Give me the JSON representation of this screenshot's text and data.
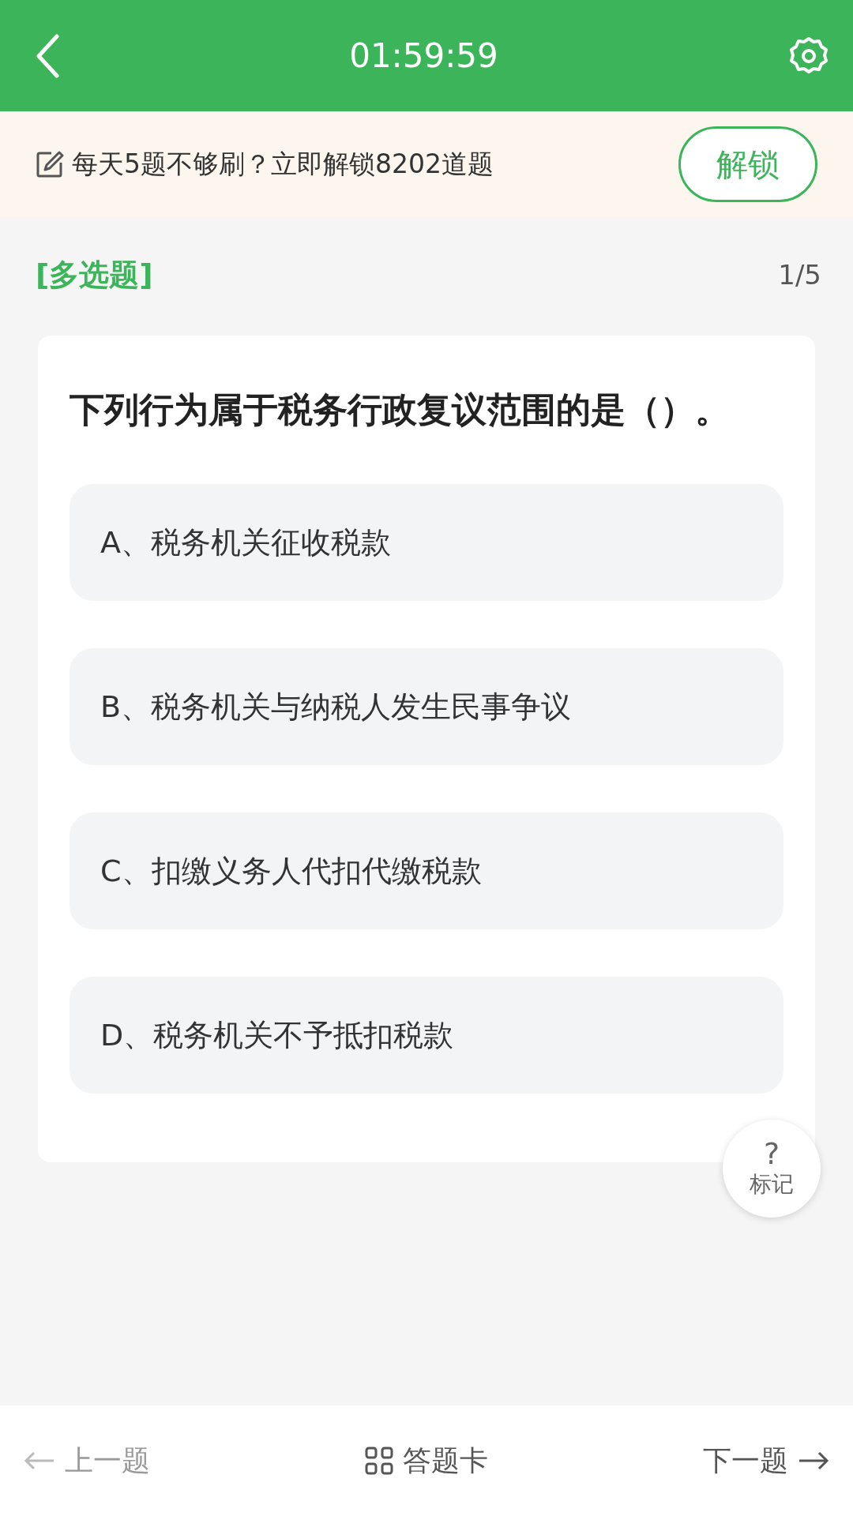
{
  "header": {
    "timer": "01:59:59"
  },
  "banner": {
    "text": "每天5题不够刷？立即解锁8202道题",
    "button": "解锁"
  },
  "question": {
    "type": "[多选题]",
    "progress": "1/5",
    "text": "下列行为属于税务行政复议范围的是（）。",
    "options": [
      {
        "label": "A、税务机关征收税款",
        "selected": false
      },
      {
        "label": "B、税务机关与纳税人发生民事争议",
        "selected": false
      },
      {
        "label": "C、扣缴义务人代扣代缴税款",
        "selected": false
      },
      {
        "label": "D、税务机关不予抵扣税款",
        "selected": false
      }
    ]
  },
  "mark_button": {
    "icon": "?",
    "label": "标记"
  },
  "bottom_bar": {
    "prev": "上一题",
    "card": "答题卡",
    "next": "下一题"
  }
}
